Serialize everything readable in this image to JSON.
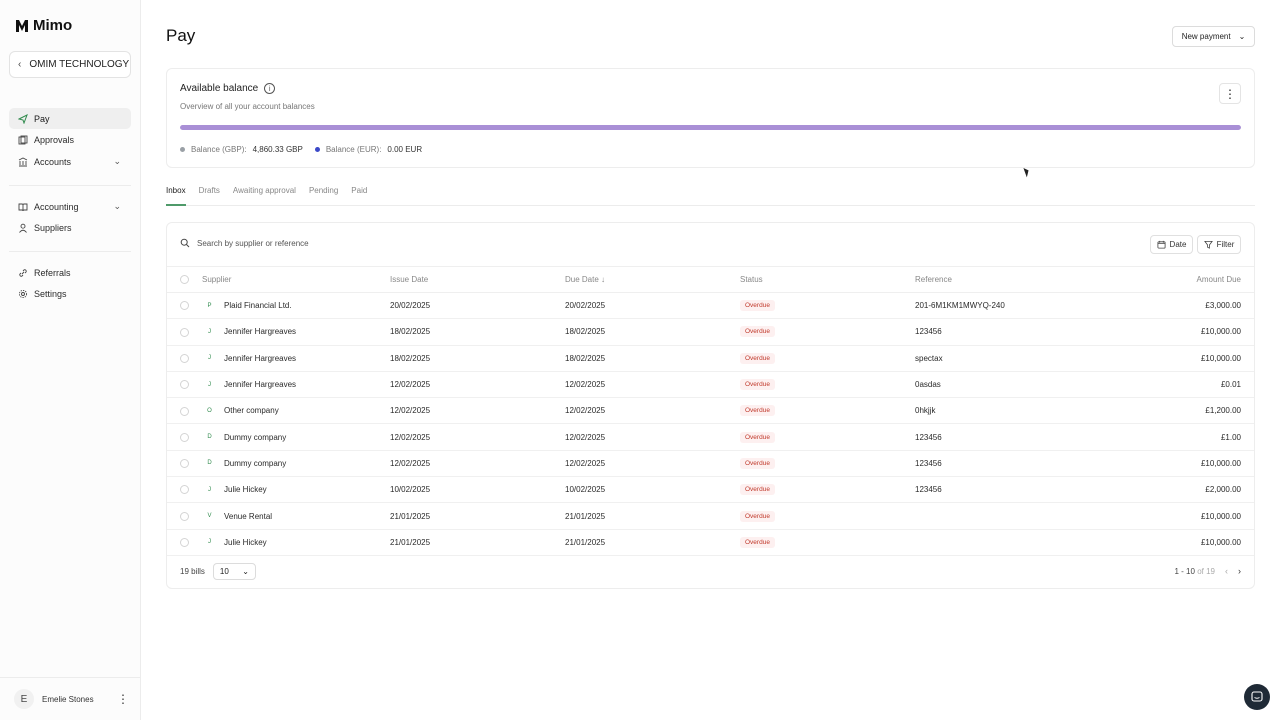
{
  "app": {
    "name": "Mimo"
  },
  "sidebar": {
    "org_name": "OMIM TECHNOLOGY ...",
    "items": [
      {
        "label": "Pay",
        "icon": "send-icon"
      },
      {
        "label": "Approvals",
        "icon": "approvals-icon"
      },
      {
        "label": "Accounts",
        "icon": "bank-icon"
      },
      {
        "label": "Accounting",
        "icon": "book-icon"
      },
      {
        "label": "Suppliers",
        "icon": "user-icon"
      },
      {
        "label": "Referrals",
        "icon": "link-icon"
      },
      {
        "label": "Settings",
        "icon": "gear-icon"
      }
    ],
    "user": {
      "initial": "E",
      "name": "Emelie Stones"
    }
  },
  "header": {
    "title": "Pay",
    "new_payment_label": "New payment"
  },
  "balance": {
    "title": "Available balance",
    "subtitle": "Overview of all your account balances",
    "bar_fraction": 1.0,
    "bar_color": "#a98fd6",
    "gbp": {
      "label": "Balance (GBP):",
      "value": "4,860.33 GBP",
      "color": "#9aa0a6"
    },
    "eur": {
      "label": "Balance (EUR):",
      "value": "0.00 EUR",
      "color": "#3b49c8"
    }
  },
  "tabs": [
    "Inbox",
    "Drafts",
    "Awaiting approval",
    "Pending",
    "Paid"
  ],
  "toolbar": {
    "search_placeholder": "Search by supplier or reference",
    "date_label": "Date",
    "filter_label": "Filter"
  },
  "table": {
    "columns": {
      "supplier": "Supplier",
      "issue": "Issue Date",
      "due": "Due Date",
      "status": "Status",
      "reference": "Reference",
      "amount": "Amount Due"
    },
    "rows": [
      {
        "initial": "P",
        "supplier": "Plaid Financial Ltd.",
        "issue": "20/02/2025",
        "due": "20/02/2025",
        "status": "Overdue",
        "reference": "201-6M1KM1MWYQ-240",
        "amount": "£3,000.00"
      },
      {
        "initial": "J",
        "supplier": "Jennifer Hargreaves",
        "issue": "18/02/2025",
        "due": "18/02/2025",
        "status": "Overdue",
        "reference": "123456",
        "amount": "£10,000.00"
      },
      {
        "initial": "J",
        "supplier": "Jennifer Hargreaves",
        "issue": "18/02/2025",
        "due": "18/02/2025",
        "status": "Overdue",
        "reference": "spectax",
        "amount": "£10,000.00"
      },
      {
        "initial": "J",
        "supplier": "Jennifer Hargreaves",
        "issue": "12/02/2025",
        "due": "12/02/2025",
        "status": "Overdue",
        "reference": "0asdas",
        "amount": "£0.01"
      },
      {
        "initial": "O",
        "supplier": "Other company",
        "issue": "12/02/2025",
        "due": "12/02/2025",
        "status": "Overdue",
        "reference": "0hkjjk",
        "amount": "£1,200.00"
      },
      {
        "initial": "D",
        "supplier": "Dummy company",
        "issue": "12/02/2025",
        "due": "12/02/2025",
        "status": "Overdue",
        "reference": "123456",
        "amount": "£1.00"
      },
      {
        "initial": "D",
        "supplier": "Dummy company",
        "issue": "12/02/2025",
        "due": "12/02/2025",
        "status": "Overdue",
        "reference": "123456",
        "amount": "£10,000.00"
      },
      {
        "initial": "J",
        "supplier": "Julie Hickey",
        "issue": "10/02/2025",
        "due": "10/02/2025",
        "status": "Overdue",
        "reference": "123456",
        "amount": "£2,000.00"
      },
      {
        "initial": "V",
        "supplier": "Venue Rental",
        "issue": "21/01/2025",
        "due": "21/01/2025",
        "status": "Overdue",
        "reference": "",
        "amount": "£10,000.00"
      },
      {
        "initial": "J",
        "supplier": "Julie Hickey",
        "issue": "21/01/2025",
        "due": "21/01/2025",
        "status": "Overdue",
        "reference": "",
        "amount": "£10,000.00"
      }
    ]
  },
  "footer": {
    "bill_count": "19 bills",
    "page_size": "10",
    "range": "1 - 10",
    "of_label": "of",
    "total": "19"
  }
}
